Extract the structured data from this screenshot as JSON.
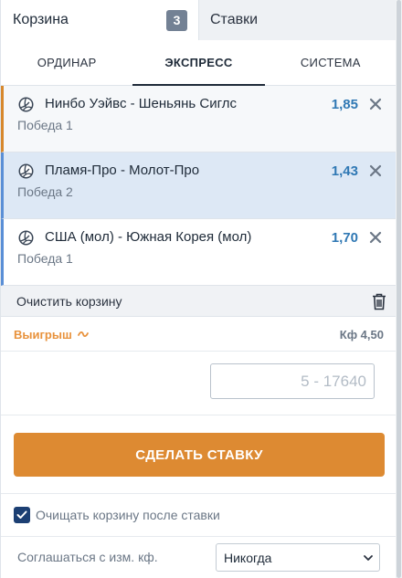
{
  "top_tabs": {
    "cart_label": "Корзина",
    "cart_count": "3",
    "bets_label": "Ставки"
  },
  "sub_tabs": [
    {
      "label": "ОРДИНАР",
      "active": false
    },
    {
      "label": "ЭКСПРЕСС",
      "active": true
    },
    {
      "label": "СИСТЕМА",
      "active": false
    }
  ],
  "bets": [
    {
      "event": "Нинбо Уэйвс - Шеньянь Сиглс",
      "outcome": "Победа 1",
      "odds": "1,85",
      "sport_icon": "volleyball-icon"
    },
    {
      "event": "Пламя-Про - Молот-Про",
      "outcome": "Победа 2",
      "odds": "1,43",
      "sport_icon": "volleyball-icon"
    },
    {
      "event": "США (мол) - Южная Корея (мол)",
      "outcome": "Победа 1",
      "odds": "1,70",
      "sport_icon": "volleyball-icon"
    }
  ],
  "clear_cart_label": "Очистить корзину",
  "win": {
    "label": "Выигрыш",
    "coef": "Кф 4,50"
  },
  "amount_input": {
    "placeholder": "5 - 17640",
    "value": ""
  },
  "make_bet_label": "СДЕЛАТЬ СТАВКУ",
  "clear_after_bet": {
    "label": "Очищать корзину после ставки",
    "checked": true
  },
  "agree_changes": {
    "label": "Соглашаться с изм. кф.",
    "selected": "Никогда"
  },
  "colors": {
    "accent_orange": "#dd8a32",
    "odds_blue": "#2f78b4",
    "selected_bg": "#dde8f5",
    "checkbox_navy": "#1c3f73"
  }
}
